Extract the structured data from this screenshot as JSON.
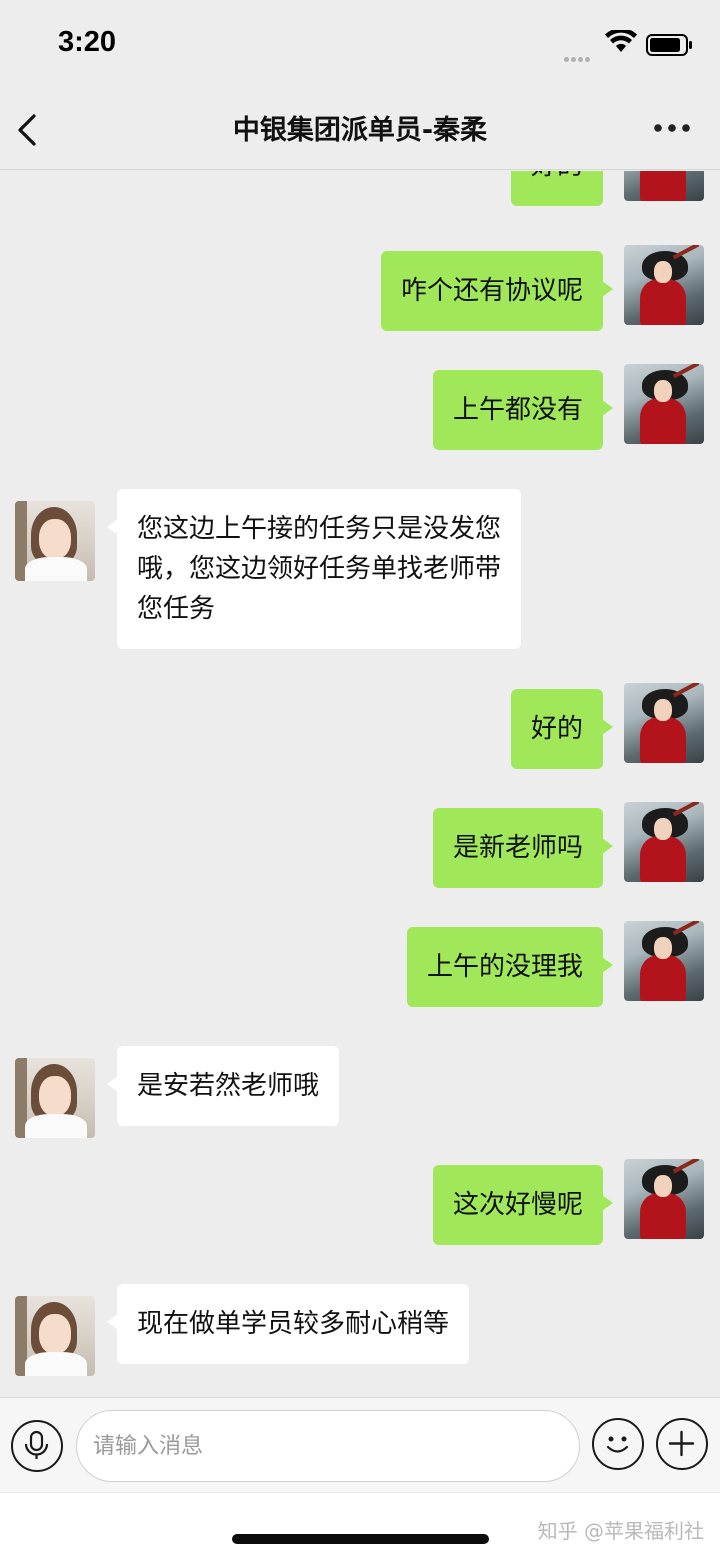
{
  "status_bar": {
    "time": "3:20",
    "signal_icon": "cellular-signal-dots",
    "wifi_icon": "wifi-icon",
    "battery_icon": "battery-icon"
  },
  "nav": {
    "back_icon": "chevron-left-icon",
    "title": "中银集团派单员-秦柔",
    "more_icon": "more-dots-icon"
  },
  "messages": [
    {
      "sender": "me",
      "text": "好的"
    },
    {
      "sender": "me",
      "text": "咋个还有协议呢"
    },
    {
      "sender": "me",
      "text": "上午都没有"
    },
    {
      "sender": "other",
      "text": "您这边上午接的任务只是没发您\n哦，您这边领好任务单找老师带\n您任务"
    },
    {
      "sender": "me",
      "text": "好的"
    },
    {
      "sender": "me",
      "text": "是新老师吗"
    },
    {
      "sender": "me",
      "text": "上午的没理我"
    },
    {
      "sender": "other",
      "text": "是安若然老师哦"
    },
    {
      "sender": "me",
      "text": "这次好慢呢"
    },
    {
      "sender": "other",
      "text": "现在做单学员较多耐心稍等"
    }
  ],
  "input_bar": {
    "voice_icon": "microphone-icon",
    "placeholder": "请输入消息",
    "emoji_icon": "smiley-icon",
    "plus_icon": "plus-icon"
  },
  "watermark": "知乎 @苹果福利社",
  "colors": {
    "background": "#ededed",
    "my_bubble": "#a0e75a",
    "other_bubble": "#ffffff"
  }
}
